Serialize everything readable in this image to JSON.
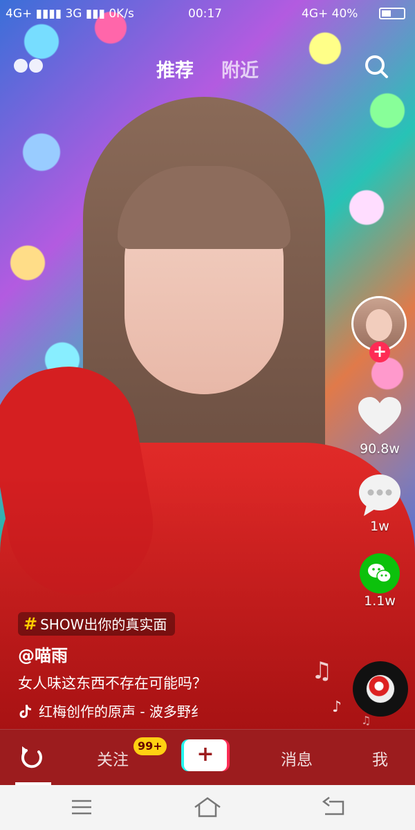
{
  "status_bar": {
    "left": "4G+ ▮▮▮▮ 3G ▮▮▮ 0K/s",
    "time": "00:17",
    "right": "4G+ 40%"
  },
  "top_tabs": {
    "recommend": "推荐",
    "nearby": "附近"
  },
  "side": {
    "likes": "90.8w",
    "comments": "1w",
    "shares": "1.1w",
    "follow_plus": "+"
  },
  "caption": {
    "hashtag_symbol": "#",
    "hashtag": "SHOW出你的真实面",
    "author": "@喵雨",
    "description": "女人味这东西不存在可能吗？",
    "music": "红梅创作的原声 - 波多野纟"
  },
  "bottom_tabs": {
    "following": "关注",
    "badge": "99+",
    "create": "+",
    "messages": "消息",
    "me": "我"
  },
  "icons": {
    "live": "live-dots-icon",
    "search": "search-icon",
    "like": "heart-icon",
    "comment": "comment-icon",
    "share": "wechat-icon",
    "music": "tiktok-note-icon",
    "refresh": "refresh-icon"
  },
  "colors": {
    "accent_red": "#fe2c55",
    "accent_cyan": "#25f4ee",
    "wechat_green": "#0cc10c",
    "badge_yellow": "#ffd012",
    "tabbar_red": "#9c1c1e"
  }
}
